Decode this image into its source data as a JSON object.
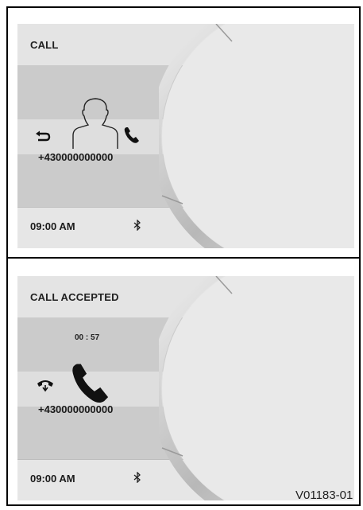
{
  "panels": [
    {
      "title": "CALL",
      "number": "+430000000000",
      "status_time": "09:00 AM",
      "icons": [
        "back-arrow-icon",
        "contact-silhouette-icon",
        "phone-icon",
        "bluetooth-icon"
      ]
    },
    {
      "title": "CALL ACCEPTED",
      "timer": "00 : 57",
      "number": "+430000000000",
      "status_time": "09:00 AM",
      "icons": [
        "end-call-icon",
        "phone-icon",
        "bluetooth-icon"
      ]
    }
  ],
  "figure_code": "V01183-01",
  "colors": {
    "screen_bg": "#e2e2e2",
    "band_dark": "#cbcbcb",
    "disc": "#e6e6e6",
    "frame": "#000000"
  }
}
